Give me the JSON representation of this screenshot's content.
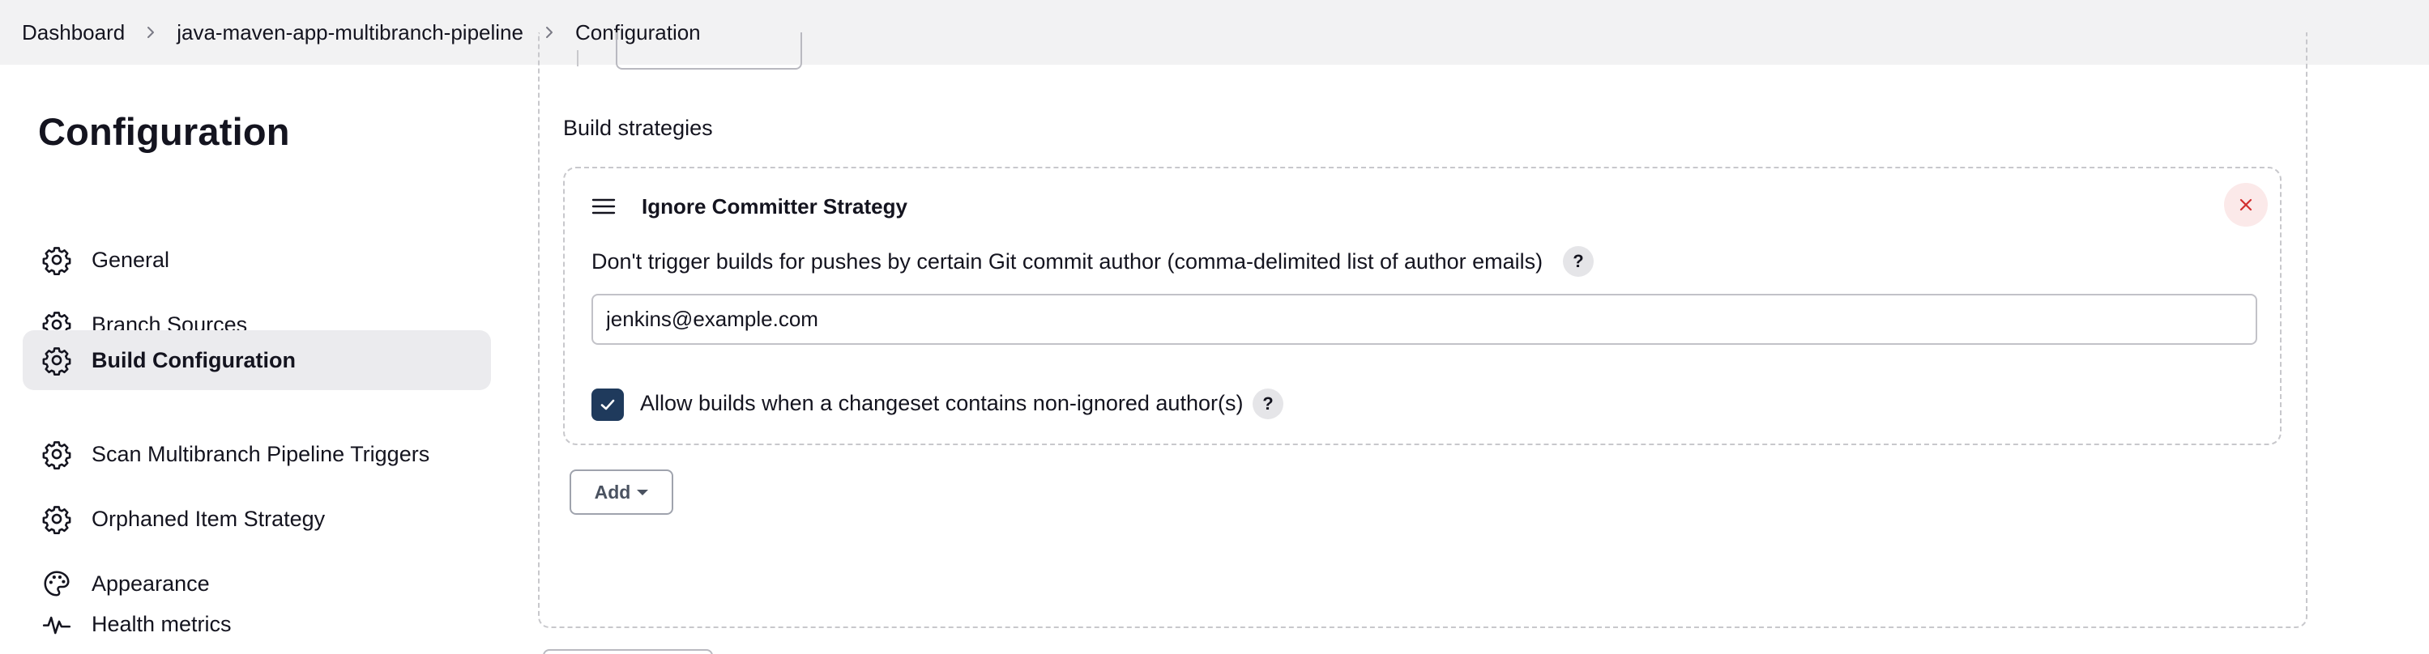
{
  "breadcrumb": {
    "items": [
      "Dashboard",
      "java-maven-app-multibranch-pipeline",
      "Configuration"
    ]
  },
  "sidebar": {
    "title": "Configuration",
    "items": [
      {
        "label": "General",
        "icon": "gear-icon",
        "active": false
      },
      {
        "label": "Branch Sources",
        "icon": "gear-icon",
        "active": false
      },
      {
        "label": "Build Configuration",
        "icon": "gear-icon",
        "active": true
      },
      {
        "label": "Scan Multibranch Pipeline Triggers",
        "icon": "gear-icon",
        "active": false
      },
      {
        "label": "Orphaned Item Strategy",
        "icon": "gear-icon",
        "active": false
      },
      {
        "label": "Appearance",
        "icon": "palette-icon",
        "active": false
      },
      {
        "label": "Health metrics",
        "icon": "pulse-icon",
        "active": false
      }
    ]
  },
  "main": {
    "section_label": "Build strategies",
    "strategy": {
      "title": "Ignore Committer Strategy",
      "field_label": "Don't trigger builds for pushes by certain Git commit author (comma-delimited list of author emails)",
      "field_value": "jenkins@example.com",
      "checkbox_label": "Allow builds when a changeset contains non-ignored author(s)",
      "checkbox_checked": true,
      "help_glyph": "?"
    },
    "add_label": "Add"
  },
  "colors": {
    "topbar_bg": "#f2f2f3",
    "active_nav_bg": "#ebebee",
    "checkbox_bg": "#1f3a5c",
    "close_bg": "#fbe9e9",
    "close_icon": "#d23030"
  }
}
